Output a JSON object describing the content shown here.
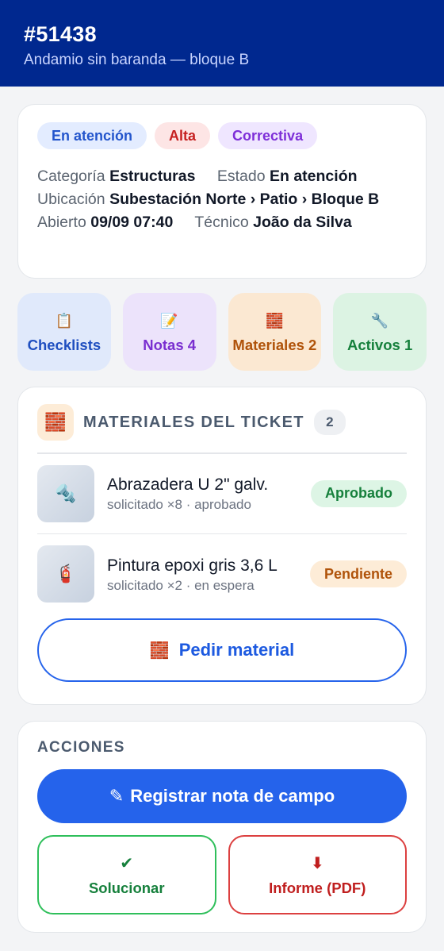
{
  "header": {
    "ticket_id": "#51438",
    "subtitle": "Andamio sin baranda — bloque B"
  },
  "summary": {
    "chips": [
      "En atención",
      "Alta",
      "Correctiva"
    ],
    "category_label": "Categoría",
    "category_value": "Estructuras",
    "state_label": "Estado",
    "state_value": "En atención",
    "location_label": "Ubicación",
    "location_value": "Subestación Norte › Patio › Bloque B",
    "opened_label": "Abierto",
    "opened_value": "09/09 07:40",
    "tech_label": "Técnico",
    "tech_value": "João da Silva"
  },
  "tiles": [
    {
      "icon": "📋",
      "label": "Checklists"
    },
    {
      "icon": "📝",
      "label": "Notas 4"
    },
    {
      "icon": "🧱",
      "label": "Materiales 2"
    },
    {
      "icon": "🔧",
      "label": "Activos 1"
    }
  ],
  "materials": {
    "header_icon": "🧱",
    "title": "MATERIALES DEL TICKET",
    "count": "2",
    "items": [
      {
        "icon": "🔩",
        "name": "Abrazadera U 2\" galv.",
        "sub": "solicitado ×8 · aprobado",
        "status": "Aprobado"
      },
      {
        "icon": "🧯",
        "name": "Pintura epoxi gris 3,6 L",
        "sub": "solicitado ×2 · en espera",
        "status": "Pendiente"
      }
    ],
    "request_icon": "🧱",
    "request_label": "Pedir material"
  },
  "actions": {
    "title": "ACCIONES",
    "primary_icon": "✎",
    "primary_label": "Registrar nota de campo",
    "solve_icon": "✔",
    "solve_label": "Solucionar",
    "report_icon": "⬇",
    "report_label": "Informe (PDF)"
  },
  "colors": {
    "header_bg": "#00288f",
    "primary": "#2563eb",
    "approved": "#16803c",
    "pending": "#b0530a",
    "danger": "#c01f1f"
  }
}
